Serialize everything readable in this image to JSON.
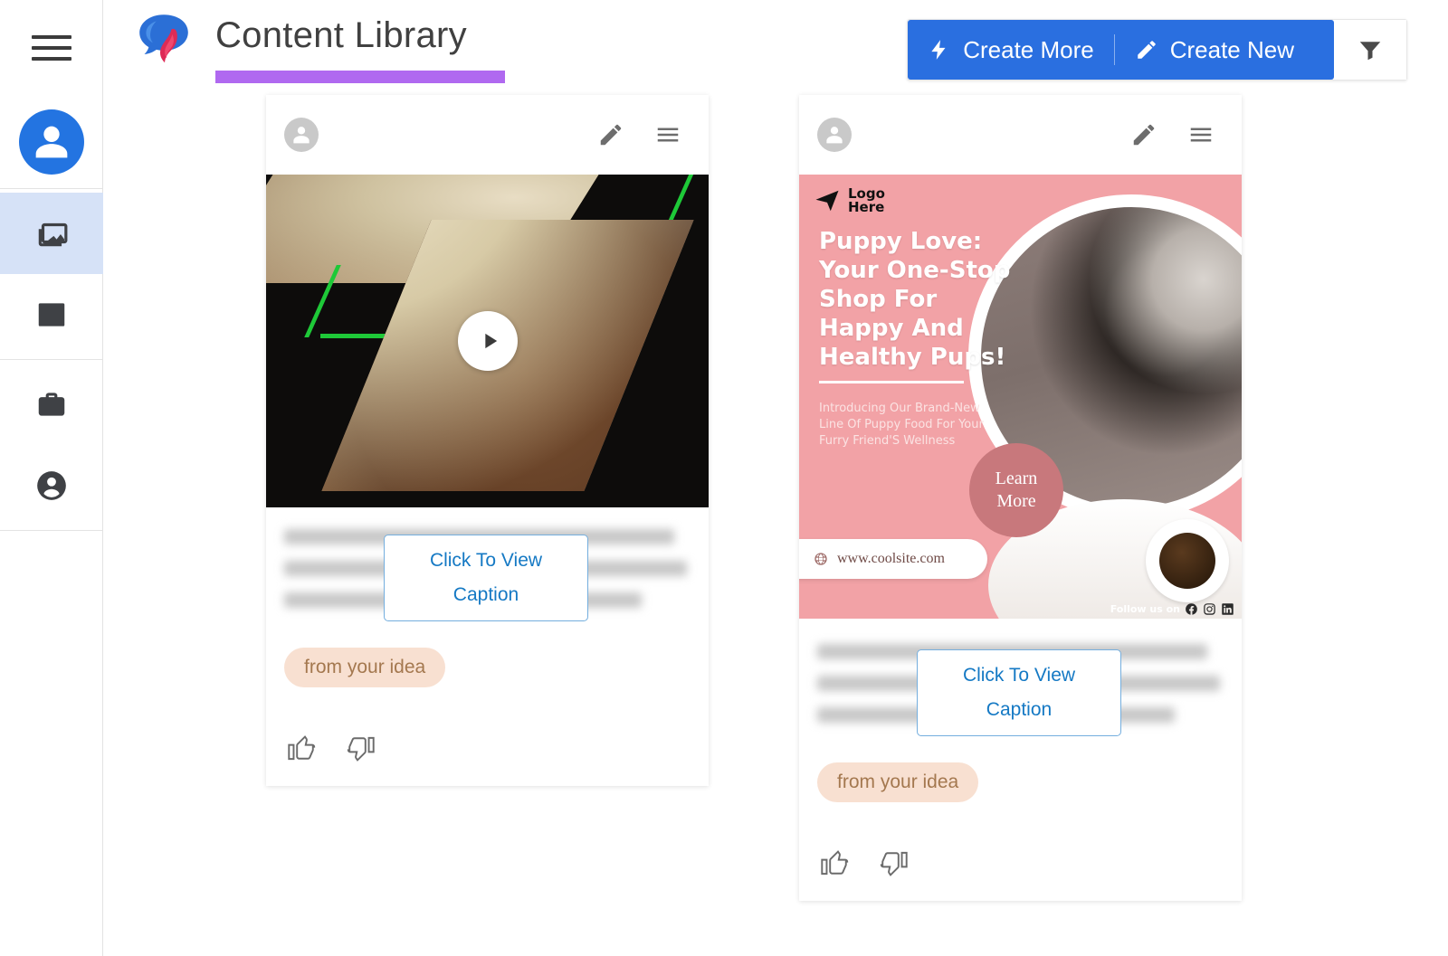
{
  "sidebar": {
    "hamburger_icon": "hamburger-menu-icon",
    "avatar_icon": "user-avatar-icon",
    "items": [
      {
        "id": "library",
        "icon": "image-library-icon",
        "active": true
      },
      {
        "id": "analytics",
        "icon": "bar-chart-icon",
        "active": false
      },
      {
        "id": "workspace",
        "icon": "briefcase-icon",
        "active": false
      },
      {
        "id": "account",
        "icon": "person-circle-icon",
        "active": false
      }
    ]
  },
  "header": {
    "logo_icon": "speech-bubble-logo",
    "title": "Content Library",
    "underline_color": "#b069f0",
    "actions": {
      "create_more_label": "Create More",
      "create_more_icon": "lightning-bolt-icon",
      "create_new_label": "Create New",
      "create_new_icon": "pencil-icon",
      "filter_icon": "funnel-filter-icon",
      "accent_color": "#2a6fe0"
    }
  },
  "cards": [
    {
      "id": "video-post",
      "avatar_icon": "user-avatar-icon",
      "edit_icon": "pencil-icon",
      "menu_icon": "hamburger-menu-icon",
      "media_type": "video",
      "play_icon": "play-button-icon",
      "caption_button_line1": "Click To View",
      "caption_button_line2": "Caption",
      "tag": "from your idea",
      "like_icon": "thumbs-up-icon",
      "dislike_icon": "thumbs-down-icon"
    },
    {
      "id": "image-post",
      "avatar_icon": "user-avatar-icon",
      "edit_icon": "pencil-icon",
      "menu_icon": "hamburger-menu-icon",
      "media_type": "image",
      "ad": {
        "logo_icon": "paper-plane-icon",
        "logo_line1": "Logo",
        "logo_line2": "Here",
        "headline": "Puppy Love: Your One-Stop Shop For Happy And Healthy Pups!",
        "subtext": "Introducing Our Brand-New Line Of Puppy Food For Your Furry Friend'S Wellness",
        "cta_line1": "Learn",
        "cta_line2": "More",
        "website_icon": "globe-icon",
        "website": "www.coolsite.com",
        "follow_label": "Follow us on",
        "social_icons": [
          "facebook-icon",
          "instagram-icon",
          "linkedin-icon"
        ],
        "background_color": "#f2a2a6",
        "cta_color": "#c8787c"
      },
      "caption_button_line1": "Click To View",
      "caption_button_line2": "Caption",
      "tag": "from your idea",
      "like_icon": "thumbs-up-icon",
      "dislike_icon": "thumbs-down-icon"
    }
  ]
}
